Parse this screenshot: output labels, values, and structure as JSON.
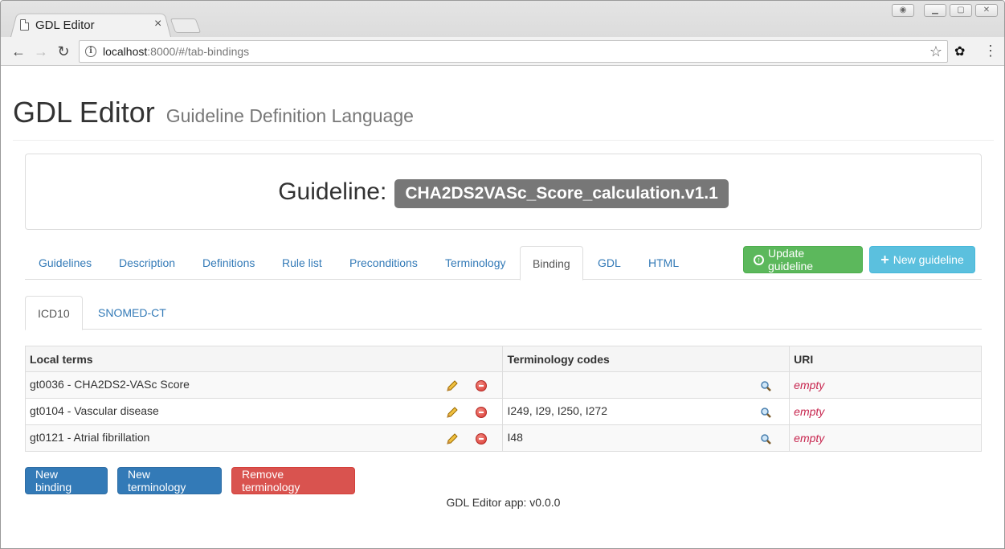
{
  "browser": {
    "tab_title": "GDL Editor",
    "url_host": "localhost",
    "url_rest": ":8000/#/tab-bindings"
  },
  "header": {
    "title": "GDL Editor",
    "subtitle": "Guideline Definition Language"
  },
  "guideline": {
    "label": "Guideline:",
    "name": "CHA2DS2VASc_Score_calculation.v1.1"
  },
  "main_tabs": [
    {
      "label": "Guidelines"
    },
    {
      "label": "Description"
    },
    {
      "label": "Definitions"
    },
    {
      "label": "Rule list"
    },
    {
      "label": "Preconditions"
    },
    {
      "label": "Terminology"
    },
    {
      "label": "Binding"
    },
    {
      "label": "GDL"
    },
    {
      "label": "HTML"
    }
  ],
  "active_main_tab": "Binding",
  "actions": {
    "update_label": "Update guideline",
    "new_label": "New guideline"
  },
  "sub_tabs": [
    {
      "label": "ICD10"
    },
    {
      "label": "SNOMED-CT"
    }
  ],
  "active_sub_tab": "ICD10",
  "table": {
    "headers": [
      "Local terms",
      "Terminology codes",
      "URI"
    ],
    "rows": [
      {
        "term": "gt0036 - CHA2DS2-VASc Score",
        "codes": "",
        "uri": "empty"
      },
      {
        "term": "gt0104 - Vascular disease",
        "codes": "I249, I29, I250, I272",
        "uri": "empty"
      },
      {
        "term": "gt0121 - Atrial fibrillation",
        "codes": "I48",
        "uri": "empty"
      }
    ]
  },
  "buttons": {
    "new_binding": "New binding",
    "new_terminology": "New terminology",
    "remove_terminology": "Remove terminology"
  },
  "footer": {
    "version": "GDL Editor app: v0.0.0"
  },
  "colors": {
    "primary": "#337ab7",
    "success": "#5cb85c",
    "info": "#5bc0de",
    "danger": "#d9534f",
    "empty_text": "#c7254e"
  }
}
